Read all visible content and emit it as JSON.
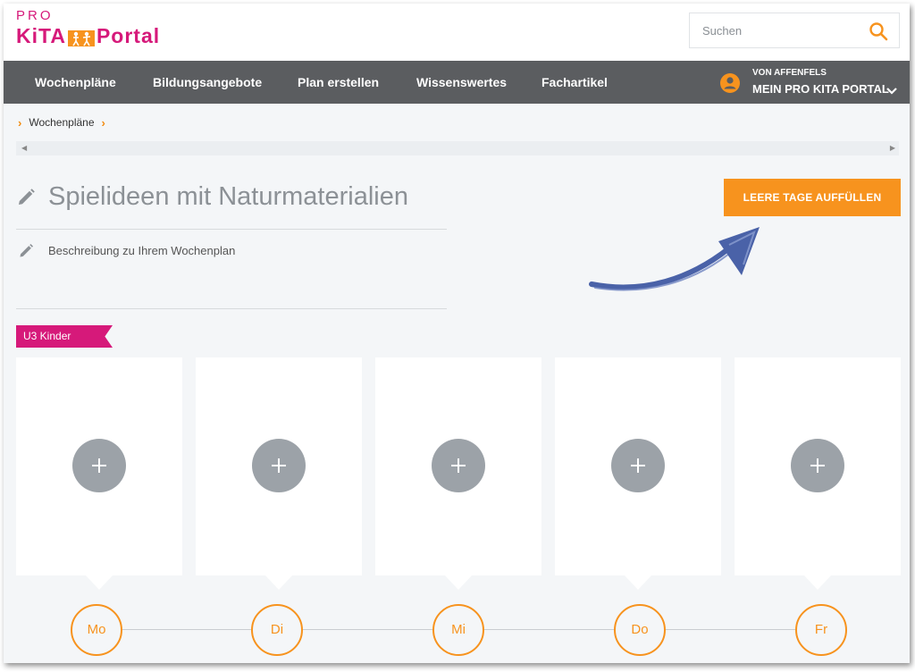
{
  "header": {
    "logo_pro": "PRO",
    "logo_kita": "KiTA",
    "logo_portal": "Portal",
    "search_placeholder": "Suchen"
  },
  "nav": {
    "items": [
      "Wochenpläne",
      "Bildungsangebote",
      "Plan erstellen",
      "Wissenswertes",
      "Fachartikel"
    ],
    "account_sub": "VON AFFENFELS",
    "account_main": "MEIN PRO KITA PORTAL"
  },
  "breadcrumb": {
    "item": "Wochenpläne"
  },
  "plan": {
    "title": "Spielideen mit Naturmaterialien",
    "description": "Beschreibung zu Ihrem Wochenplan",
    "fill_button": "LEERE TAGE AUFFÜLLEN",
    "group_tag": "U3 Kinder"
  },
  "days": [
    "Mo",
    "Di",
    "Mi",
    "Do",
    "Fr"
  ],
  "colors": {
    "brand_pink": "#d6197a",
    "accent_orange": "#f7931e",
    "nav_bg": "#5b5d60",
    "add_grey": "#9ca2a8"
  }
}
